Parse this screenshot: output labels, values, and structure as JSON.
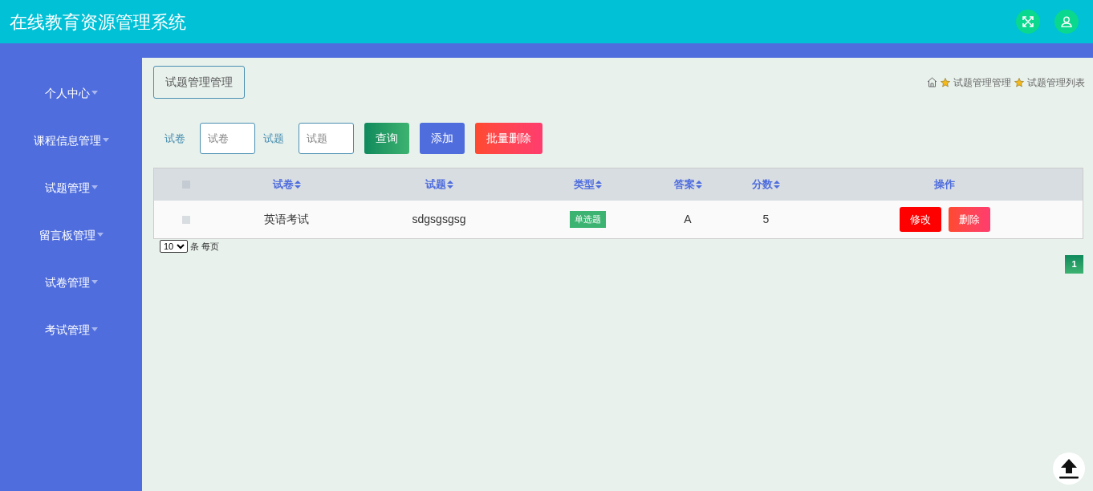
{
  "header": {
    "title": "在线教育资源管理系统"
  },
  "sidebar": {
    "items": [
      {
        "label": "个人中心"
      },
      {
        "label": "课程信息管理"
      },
      {
        "label": "试题管理"
      },
      {
        "label": "留言板管理"
      },
      {
        "label": "试卷管理"
      },
      {
        "label": "考试管理"
      }
    ]
  },
  "page_title": "试题管理管理",
  "breadcrumb": [
    "试题管理管理",
    "试题管理列表"
  ],
  "search": {
    "fields": [
      {
        "label": "试卷",
        "placeholder": "试卷"
      },
      {
        "label": "试题",
        "placeholder": "试题"
      }
    ],
    "buttons": [
      {
        "label": "查询",
        "kind": "query"
      },
      {
        "label": "添加",
        "kind": "add"
      },
      {
        "label": "批量删除",
        "kind": "delete"
      }
    ]
  },
  "table": {
    "header_checked": false,
    "columns": [
      "试卷",
      "试题",
      "类型",
      "答案",
      "分数",
      "操作"
    ],
    "rows": [
      {
        "checked": false,
        "paper": "英语考试",
        "question": "sdgsgsgsg",
        "type": "单选题",
        "answer": "A",
        "score": "5",
        "actions": [
          "修改",
          "删除"
        ]
      }
    ]
  },
  "page_size": {
    "value": "10",
    "suffix": "条 每页"
  },
  "pagination": [
    {
      "label": "1",
      "selected": true
    }
  ]
}
